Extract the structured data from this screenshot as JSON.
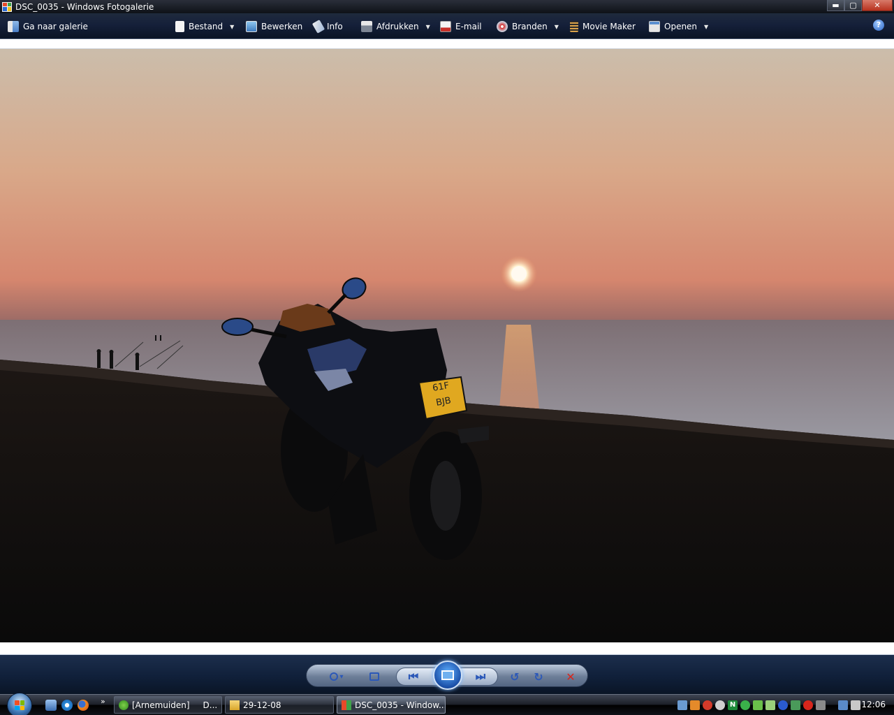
{
  "window": {
    "title": "DSC_0035 - Windows Fotogalerie",
    "buttons": {
      "minimize": "▬",
      "maximize": "▢",
      "close": "✕"
    }
  },
  "toolbar": {
    "goto_gallery": "Ga naar galerie",
    "file": "Bestand",
    "edit": "Bewerken",
    "info": "Info",
    "print": "Afdrukken",
    "email": "E-mail",
    "burn": "Branden",
    "movie_maker": "Movie Maker",
    "open": "Openen",
    "help": "?",
    "dropdown_caret": "▼"
  },
  "photo": {
    "plate_line1": "61F",
    "plate_line2": "BJB"
  },
  "controls": {
    "zoom_caret": "▾",
    "prev": "⏮",
    "next": "⏭",
    "rotate_ccw": "↺",
    "rotate_cw": "↻",
    "delete": "✕"
  },
  "taskbar": {
    "more": "»",
    "tasks": [
      {
        "label": "[Arnemuiden]",
        "label2": "D..."
      },
      {
        "label": "29-12-08"
      },
      {
        "label": "DSC_0035 - Window..."
      }
    ],
    "clock": "12:06",
    "tray_letter": "N"
  },
  "colors": {
    "toolbar_dark": "#0a1424",
    "sky_top": "#c9bcab",
    "sky_horizon": "#d98d72",
    "sun": "#fff6e0",
    "ground": "#0d0c0b"
  }
}
